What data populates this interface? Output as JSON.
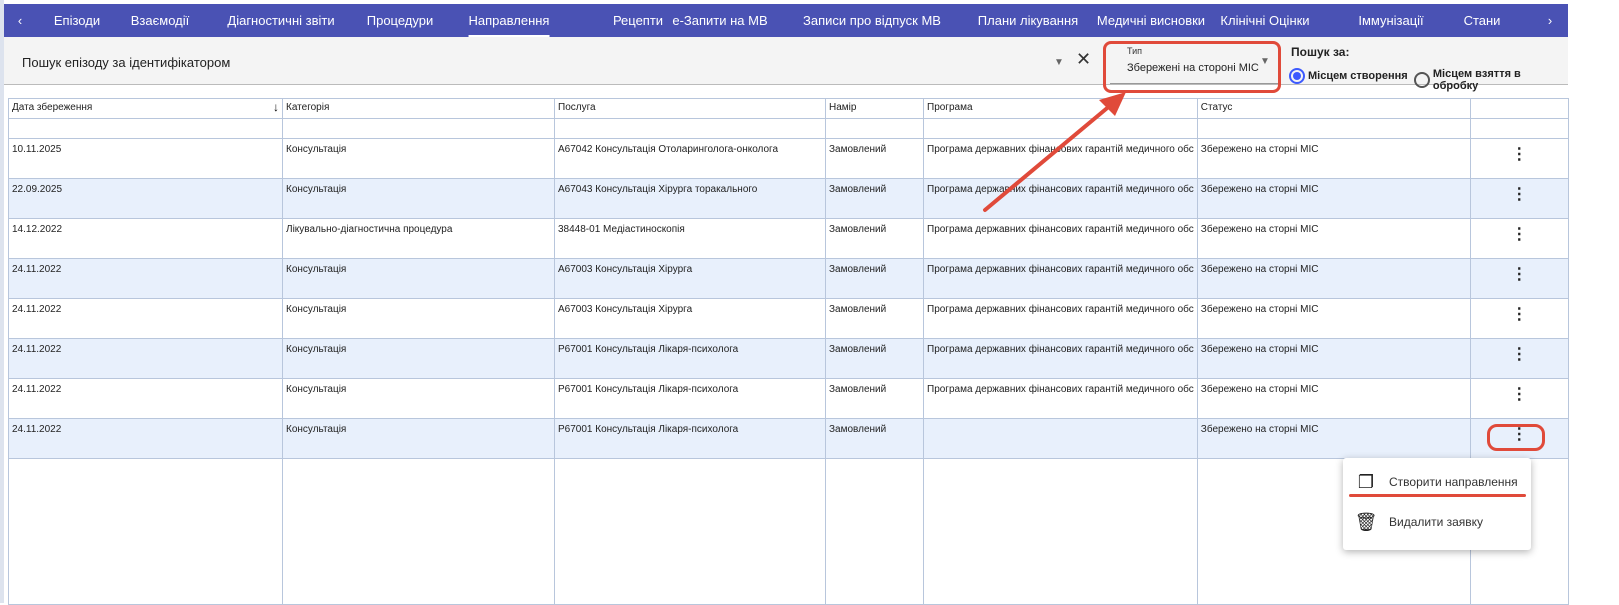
{
  "tabs": [
    {
      "label": "Епізоди"
    },
    {
      "label": "Взаємодії"
    },
    {
      "label": "Діагностичні звіти"
    },
    {
      "label": "Процедури"
    },
    {
      "label": "Направлення",
      "active": true
    },
    {
      "label": "Рецепти"
    },
    {
      "label": "е-Запити на МВ"
    },
    {
      "label": "Записи про відпуск МВ"
    },
    {
      "label": "Плани лікування"
    },
    {
      "label": "Медичні висновки"
    },
    {
      "label": "Клінічні Оцінки"
    },
    {
      "label": "Іммунізації"
    },
    {
      "label": "Стани"
    }
  ],
  "nav": {
    "prev": "‹",
    "next": "›"
  },
  "toolbar": {
    "search_placeholder": "Пошук епізоду за ідентифікатором",
    "type_label": "Тип",
    "type_value": "Збережені на стороні МІС",
    "search_by_label": "Пошук за:",
    "radio_creation": "Місцем створення",
    "radio_processing": "Місцем взяття в обробку"
  },
  "table": {
    "columns": [
      "Дата збереження",
      "Категорія",
      "Послуга",
      "Намір",
      "Програма",
      "Статус"
    ],
    "rows": [
      [
        "10.11.2025",
        "Консультація",
        "А67042 Консультація Отоларинголога-онколога",
        "Замовлений",
        "Програма державних фінансових гарантій медичного обс",
        "Збережено на сторні МІС"
      ],
      [
        "22.09.2025",
        "Консультація",
        "А67043 Консультація Хірурга торакального",
        "Замовлений",
        "Програма державних фінансових гарантій медичного обс",
        "Збережено на сторні МІС"
      ],
      [
        "14.12.2022",
        "Лікувально-діагностична процедура",
        "38448-01 Медіастиноскопія",
        "Замовлений",
        "Програма державних фінансових гарантій медичного обс",
        "Збережено на сторні МІС"
      ],
      [
        "24.11.2022",
        "Консультація",
        "А67003 Консультація Хірурга",
        "Замовлений",
        "Програма державних фінансових гарантій медичного обс",
        "Збережено на сторні МІС"
      ],
      [
        "24.11.2022",
        "Консультація",
        "А67003 Консультація Хірурга",
        "Замовлений",
        "Програма державних фінансових гарантій медичного обс",
        "Збережено на сторні МІС"
      ],
      [
        "24.11.2022",
        "Консультація",
        "Р67001 Консультація Лікаря-психолога",
        "Замовлений",
        "Програма державних фінансових гарантій медичного обс",
        "Збережено на сторні МІС"
      ],
      [
        "24.11.2022",
        "Консультація",
        "Р67001 Консультація Лікаря-психолога",
        "Замовлений",
        "Програма державних фінансових гарантій медичного обс",
        "Збережено на сторні МІС"
      ],
      [
        "24.11.2022",
        "Консультація",
        "Р67001 Консультація Лікаря-психолога",
        "Замовлений",
        "",
        "Збережено на сторні МІС"
      ]
    ]
  },
  "menu": {
    "create": "Створити направлення",
    "delete": "Видалити заявку"
  },
  "colors": {
    "tabbar": "#4a52b4",
    "highlight": "#e04a3a",
    "row_alt": "#e8f0fc",
    "radio": "#3d5afe"
  }
}
